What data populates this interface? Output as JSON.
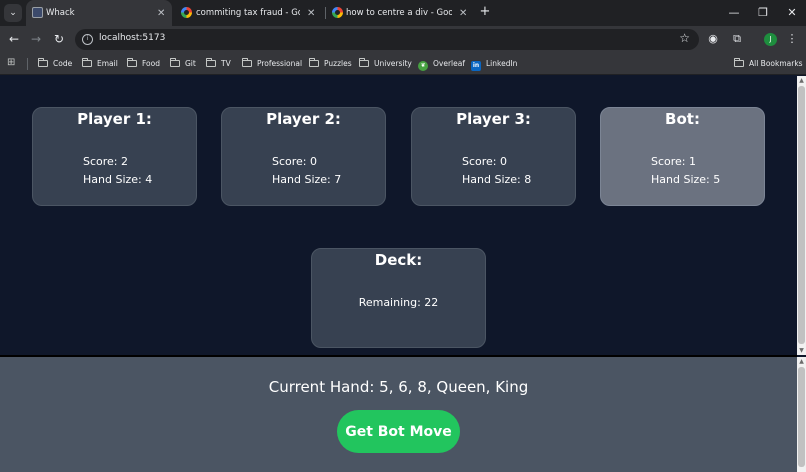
{
  "browser": {
    "tabs": [
      {
        "title": "Whack",
        "active": true
      },
      {
        "title": "commiting tax fraud - Google S",
        "active": false
      },
      {
        "title": "how to centre a div - Google Se",
        "active": false
      }
    ],
    "url": "localhost:5173",
    "profile_initial": "J",
    "bookmarks": [
      "Code",
      "Email",
      "Food",
      "Git",
      "TV",
      "Professional",
      "Puzzles",
      "University",
      "Overleaf",
      "LinkedIn"
    ],
    "all_bookmarks": "All Bookmarks"
  },
  "game": {
    "players": [
      {
        "title": "Player 1:",
        "score": "Score: 2",
        "hand": "Hand Size: 4"
      },
      {
        "title": "Player 2:",
        "score": "Score: 0",
        "hand": "Hand Size: 7"
      },
      {
        "title": "Player 3:",
        "score": "Score: 0",
        "hand": "Hand Size: 8"
      },
      {
        "title": "Bot:",
        "score": "Score: 1",
        "hand": "Hand Size: 5"
      }
    ],
    "deck": {
      "title": "Deck:",
      "remaining": "Remaining: 22"
    },
    "current_hand": "Current Hand: 5, 6, 8, Queen, King",
    "bot_button": "Get Bot Move"
  },
  "colors": {
    "page_bg": "#0f172a",
    "card_bg": "#374151",
    "bot_card_bg": "#6b7280",
    "hand_panel_bg": "#4b5563",
    "button_green": "#22c55e"
  }
}
